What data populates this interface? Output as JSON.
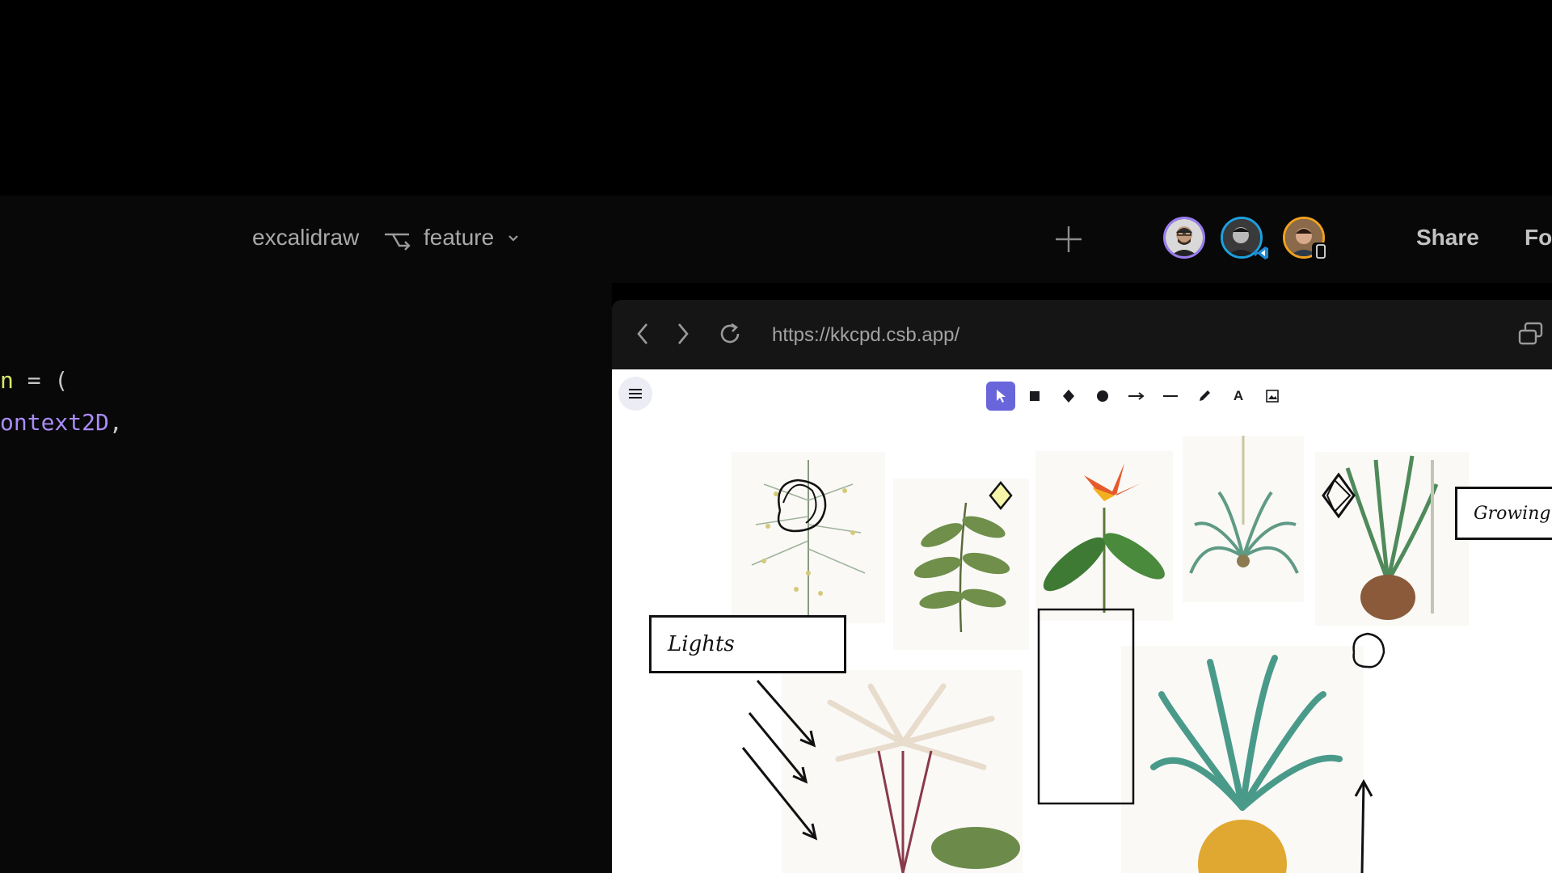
{
  "header": {
    "repo_name": "excalidraw",
    "branch_name": "feature",
    "share_label": "Share",
    "follow_label_partial": "Fo"
  },
  "avatars": [
    {
      "name": "user-1",
      "ring_color": "#9b7cf0"
    },
    {
      "name": "user-2",
      "ring_color": "#1ca0e0",
      "badge": "vscode-icon"
    },
    {
      "name": "user-3",
      "ring_color": "#f0a11f",
      "badge": "mobile-icon"
    }
  ],
  "editor": {
    "line1": {
      "fn": "n",
      "op": " = ("
    },
    "line2": {
      "id": "ontext2D",
      "op": ","
    }
  },
  "browser": {
    "url": "https://kkcpd.csb.app/"
  },
  "excalidraw": {
    "tools": [
      "selection-tool",
      "rectangle-tool",
      "diamond-tool",
      "ellipse-tool",
      "arrow-tool",
      "line-tool",
      "draw-tool",
      "text-tool",
      "image-tool"
    ],
    "active_tool": "selection-tool",
    "text_tool_glyph": "A",
    "label_lights": "Lights",
    "label_growing": "Growing",
    "accent_color": "#6965db"
  }
}
